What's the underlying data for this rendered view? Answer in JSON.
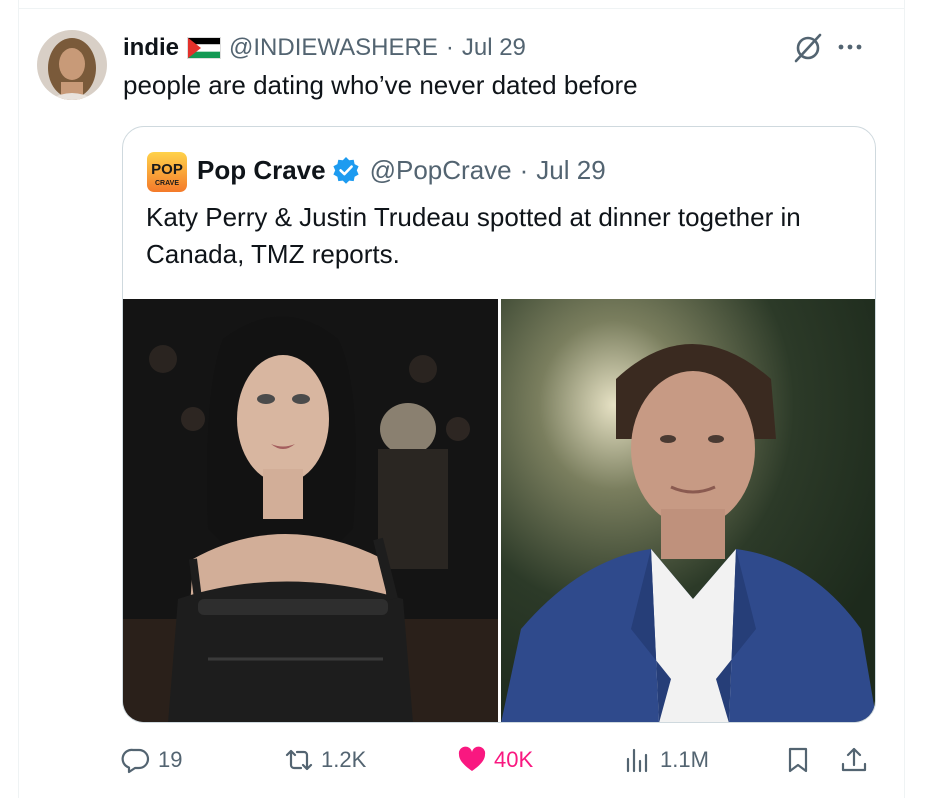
{
  "tweet": {
    "author": {
      "display_name": "indie",
      "handle": "@INDIEWASHERE",
      "date": "Jul 29",
      "avatar": "avatar",
      "flag": "palestine-flag-icon"
    },
    "text": "people are dating who’ve never dated before",
    "quoted": {
      "author": {
        "display_name": "Pop Crave",
        "handle": "@PopCrave",
        "date": "Jul 29",
        "logo_text": "POP",
        "logo_subtext": "CRAVE",
        "verified": true
      },
      "text": "Katy Perry & Justin Trudeau spotted at dinner together in Canada, TMZ reports.",
      "media": [
        "photo-woman-dark-hair",
        "photo-man-blue-suit"
      ]
    },
    "actions": {
      "replies": "19",
      "reposts": "1.2K",
      "likes": "40K",
      "views": "1.1M"
    },
    "separator_dot": "·"
  },
  "colors": {
    "text": "#0f1419",
    "muted": "#536471",
    "like": "#f91880",
    "verified": "#1d9bf0",
    "border": "#cfd9de"
  }
}
